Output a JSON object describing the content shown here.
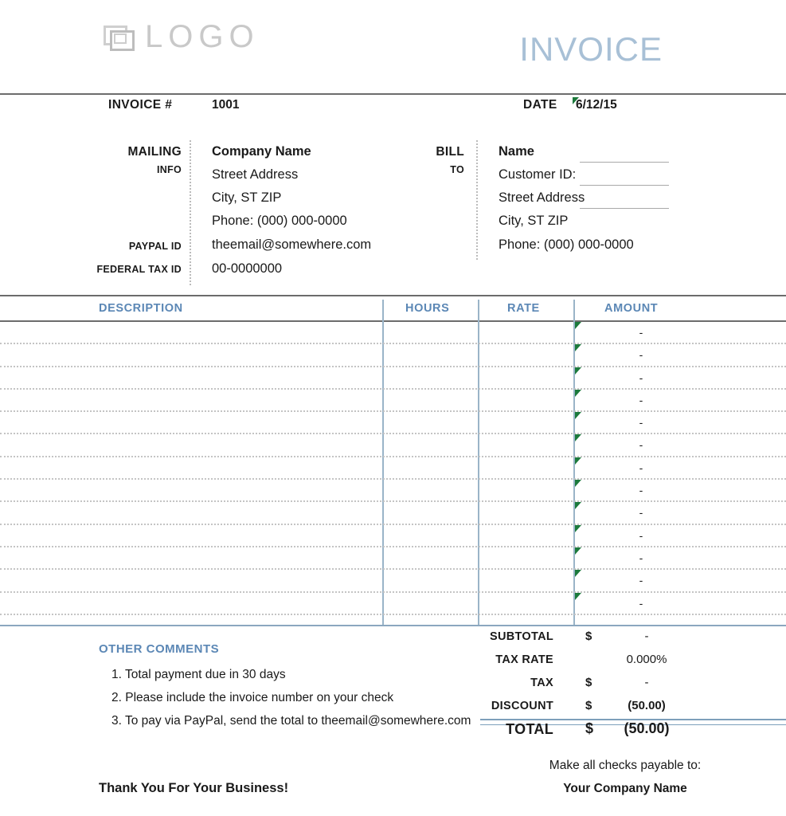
{
  "header": {
    "logo_text": "LOGO",
    "logo_icon": "picture-frame-icon",
    "title": "INVOICE"
  },
  "meta": {
    "invoice_label": "INVOICE #",
    "invoice_number": "1001",
    "date_label": "DATE",
    "date_value": "6/12/15"
  },
  "mailing": {
    "label": "MAILING",
    "label2": "INFO",
    "paypal_label": "PAYPAL ID",
    "federal_tax_label": "FEDERAL TAX ID",
    "lines": [
      "Company Name",
      "Street Address",
      "City, ST  ZIP",
      "Phone: (000) 000-0000",
      "theemail@somewhere.com",
      "00-0000000"
    ]
  },
  "bill_to": {
    "label": "BILL",
    "label2": "TO",
    "lines": [
      "Name",
      "Customer ID:",
      "Street Address",
      "City, ST  ZIP",
      "Phone: (000) 000-0000"
    ]
  },
  "table": {
    "columns": [
      "DESCRIPTION",
      "HOURS",
      "RATE",
      "AMOUNT"
    ],
    "row_count": 13,
    "empty_amount": "-",
    "rows": [
      {
        "description": "",
        "hours": "",
        "rate": "",
        "amount": "-"
      },
      {
        "description": "",
        "hours": "",
        "rate": "",
        "amount": "-"
      },
      {
        "description": "",
        "hours": "",
        "rate": "",
        "amount": "-"
      },
      {
        "description": "",
        "hours": "",
        "rate": "",
        "amount": "-"
      },
      {
        "description": "",
        "hours": "",
        "rate": "",
        "amount": "-"
      },
      {
        "description": "",
        "hours": "",
        "rate": "",
        "amount": "-"
      },
      {
        "description": "",
        "hours": "",
        "rate": "",
        "amount": "-"
      },
      {
        "description": "",
        "hours": "",
        "rate": "",
        "amount": "-"
      },
      {
        "description": "",
        "hours": "",
        "rate": "",
        "amount": "-"
      },
      {
        "description": "",
        "hours": "",
        "rate": "",
        "amount": "-"
      },
      {
        "description": "",
        "hours": "",
        "rate": "",
        "amount": "-"
      },
      {
        "description": "",
        "hours": "",
        "rate": "",
        "amount": "-"
      },
      {
        "description": "",
        "hours": "",
        "rate": "",
        "amount": "-"
      }
    ]
  },
  "totals": [
    {
      "label": "SUBTOTAL",
      "currency": "$",
      "value": "-",
      "bold_value": false
    },
    {
      "label": "TAX RATE",
      "currency": "",
      "value": "0.000%",
      "bold_value": false
    },
    {
      "label": "TAX",
      "currency": "$",
      "value": "-",
      "bold_value": false
    },
    {
      "label": "DISCOUNT",
      "currency": "$",
      "value": "(50.00)",
      "bold_value": true
    },
    {
      "label": "TOTAL",
      "currency": "$",
      "value": "(50.00)",
      "bold_value": true
    }
  ],
  "comments": {
    "title": "OTHER COMMENTS",
    "lines": [
      "1. Total payment due in 30 days",
      "2. Please include the invoice number on your check",
      "3. To pay via PayPal, send the total to theemail@somewhere.com"
    ]
  },
  "footer": {
    "thanks": "Thank You For Your Business!",
    "payable_to": "Make all checks payable to:",
    "payable_name": "Your Company Name"
  },
  "colors": {
    "accent_blue": "#5b87b5",
    "title_blue": "#a8c0d6",
    "rule_gray": "#6c6c6c",
    "comment_marker_green": "#1c7a3c"
  }
}
